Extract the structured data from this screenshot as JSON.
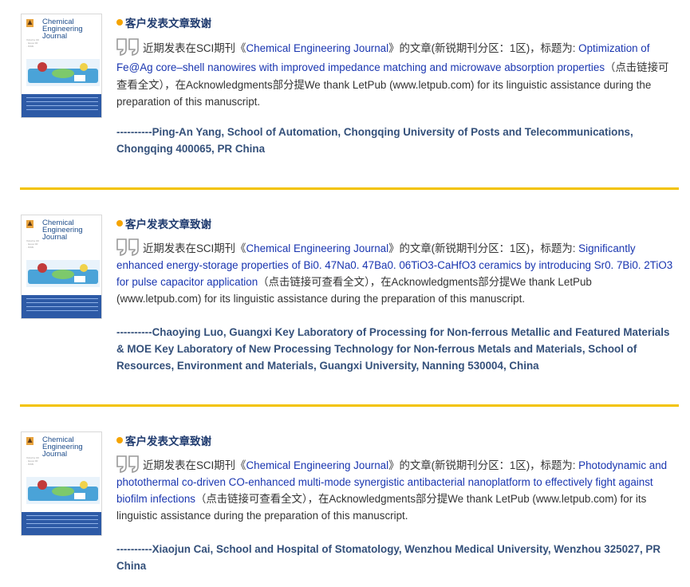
{
  "entries": [
    {
      "cover": {
        "title_lines": [
          "Chemical",
          "Engineering",
          "Journal"
        ],
        "side_text": "Volume 00 · Issue 00 · ISSN"
      },
      "heading": "客户发表文章致谢",
      "intro": "近期发表在SCI期刊《",
      "journal": "Chemical Engineering Journal",
      "after_journal": "》的文章(新锐期刊分区：1区)，标题为: ",
      "article_title": "Optimization of Fe@Ag core–shell nanowires with improved impedance matching and microwave absorption properties",
      "after_title": "（点击链接可查看全文），在Acknowledgments部分提We thank LetPub (www.letpub.com) for its linguistic assistance during the preparation of this manuscript.",
      "author": "----------Ping-An Yang, School of Automation, Chongqing University of Posts and Telecommunications, Chongqing 400065, PR China"
    },
    {
      "cover": {
        "title_lines": [
          "Chemical",
          "Engineering",
          "Journal"
        ],
        "side_text": "Volume 00 · Issue 00 · ISSN"
      },
      "heading": "客户发表文章致谢",
      "intro": "近期发表在SCI期刊《",
      "journal": "Chemical Engineering Journal",
      "after_journal": "》的文章(新锐期刊分区：1区)，标题为: ",
      "article_title": "Significantly enhanced energy-storage properties of Bi0. 47Na0. 47Ba0. 06TiO3-CaHfO3 ceramics by introducing Sr0. 7Bi0. 2TiO3 for pulse capacitor application",
      "after_title": "（点击链接可查看全文），在Acknowledgments部分提We thank LetPub (www.letpub.com) for its linguistic assistance during the preparation of this manuscript.",
      "author": "----------Chaoying Luo, Guangxi Key Laboratory of Processing for Non-ferrous Metallic and Featured Materials & MOE Key Laboratory of New Processing Technology for Non-ferrous Metals and Materials, School of Resources, Environment and Materials, Guangxi University, Nanning 530004, China"
    },
    {
      "cover": {
        "title_lines": [
          "Chemical",
          "Engineering",
          "Journal"
        ],
        "side_text": "Volume 00 · Issue 00 · ISSN"
      },
      "heading": "客户发表文章致谢",
      "intro": "近期发表在SCI期刊《",
      "journal": "Chemical Engineering Journal",
      "after_journal": "》的文章(新锐期刊分区：1区)，标题为: ",
      "article_title": "Photodynamic and photothermal co-driven CO-enhanced multi-mode synergistic antibacterial nanoplatform to effectively fight against biofilm infections",
      "after_title": "（点击链接可查看全文），在Acknowledgments部分提We thank LetPub (www.letpub.com) for its linguistic assistance during the preparation of this manuscript.",
      "author": "----------Xiaojun Cai, School and Hospital of Stomatology, Wenzhou Medical University, Wenzhou 325027, PR China"
    }
  ],
  "colors": {
    "heading": "#1e3a6e",
    "link": "#1a36b0",
    "author": "#34507a",
    "divider": "#f3c300",
    "bullet": "#f5a400",
    "cover_band": "#2d5aa6"
  },
  "icons": {
    "quote": "quote-icon",
    "bullet": "bullet-dot-icon",
    "publisher_logo": "elsevier-tree-logo-icon"
  }
}
